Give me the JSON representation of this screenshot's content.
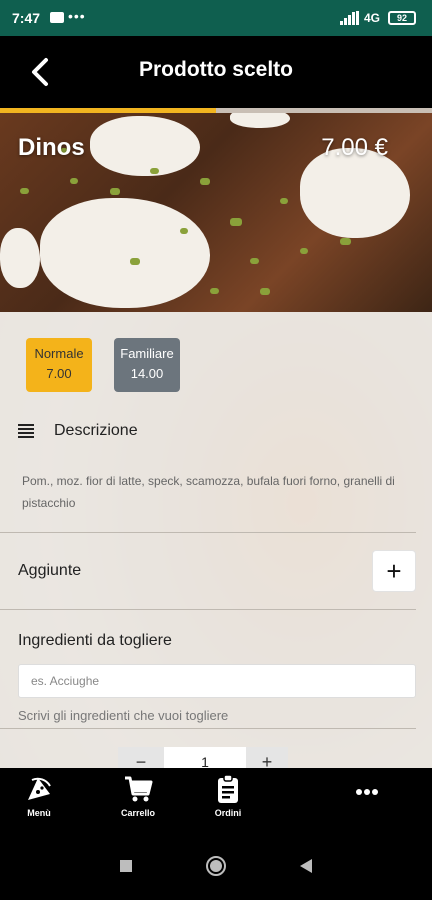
{
  "status_bar": {
    "time": "7:47",
    "dots": "•••",
    "network": "4G",
    "battery": "92"
  },
  "header": {
    "title": "Prodotto scelto",
    "back_icon": "chevron-left-icon"
  },
  "product": {
    "name": "Dinos",
    "price": "7.00 €",
    "image_progress": 0.5
  },
  "sizes": [
    {
      "name": "Normale",
      "price": "7.00",
      "selected": true,
      "color": "#f4b31a"
    },
    {
      "name": "Familiare",
      "price": "14.00",
      "selected": false,
      "color": "#6c757d"
    }
  ],
  "description": {
    "label": "Descrizione",
    "text": "Pom., moz. fior di latte, speck, scamozza, bufala fuori forno, granelli di pistacchio"
  },
  "addons": {
    "label": "Aggiunte",
    "add_symbol": "+"
  },
  "remove_ingredients": {
    "label": "Ingredienti da togliere",
    "placeholder": "es. Acciughe",
    "value": "",
    "hint": "Scrivi gli ingredienti che vuoi togliere"
  },
  "quantity": {
    "minus": "−",
    "value": "1",
    "plus": "+"
  },
  "bottom_nav": [
    {
      "label": "Menù",
      "icon": "pizza-wifi-icon"
    },
    {
      "label": "Carrello",
      "icon": "cart-icon"
    },
    {
      "label": "Ordini",
      "icon": "clipboard-icon"
    },
    {
      "label": "",
      "icon": "more-dots-icon"
    }
  ],
  "colors": {
    "status_bar": "#0f5f4f",
    "accent": "#f4b31a",
    "secondary": "#6c757d"
  }
}
